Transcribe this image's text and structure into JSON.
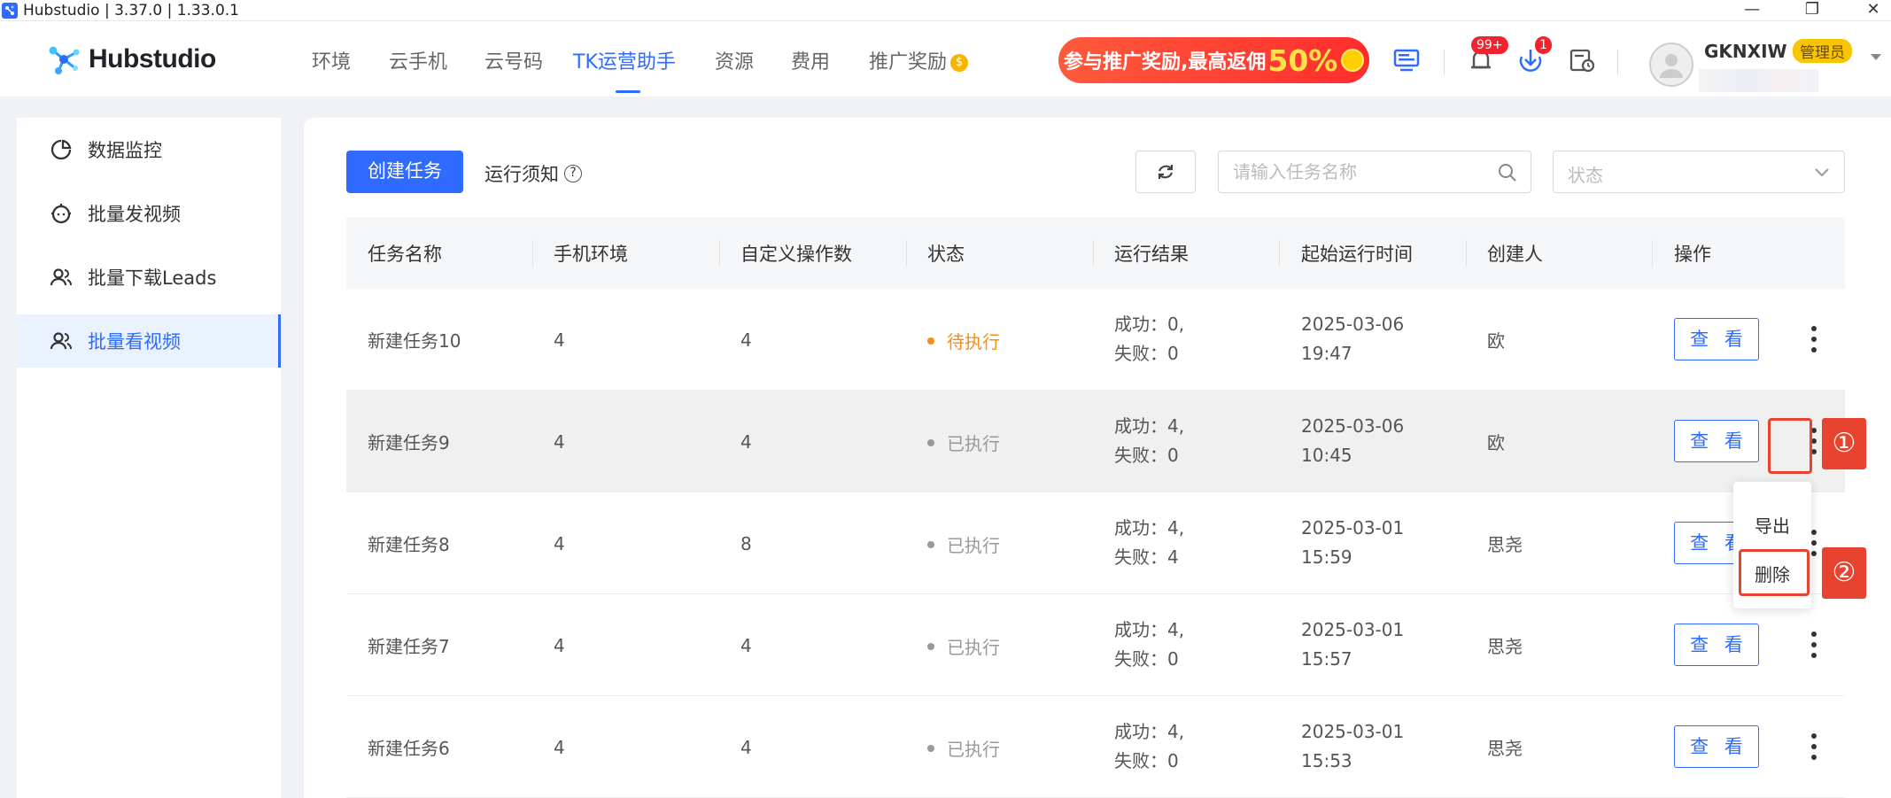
{
  "window": {
    "title": "Hubstudio | 3.37.0 | 1.33.0.1",
    "minimize_glyph": "—",
    "maximize_glyph": "❐",
    "close_glyph": "✕"
  },
  "header": {
    "brand": "Hubstudio",
    "nav": [
      {
        "label": "环境"
      },
      {
        "label": "云手机"
      },
      {
        "label": "云号码"
      },
      {
        "label": "TK运营助手"
      },
      {
        "label": "资源"
      },
      {
        "label": "费用"
      },
      {
        "label": "推广奖励"
      }
    ],
    "active_nav": "TK运营助手",
    "reward_coin": "$",
    "promo": {
      "text": "参与推广奖励,最高返佣",
      "highlight": "50%"
    },
    "notification_badge": "99+",
    "download_badge": "1",
    "username": "GKNXIW",
    "role": "管理员"
  },
  "sidebar": {
    "items": [
      {
        "label": "数据监控",
        "icon": "chart-pie-icon"
      },
      {
        "label": "批量发视频",
        "icon": "robot-icon"
      },
      {
        "label": "批量下载Leads",
        "icon": "users-icon"
      },
      {
        "label": "批量看视频",
        "icon": "users-icon"
      }
    ],
    "active_index": 3
  },
  "toolbar": {
    "create_label": "创建任务",
    "notice_label": "运行须知",
    "notice_icon": "?",
    "search_placeholder": "请输入任务名称",
    "status_placeholder": "状态"
  },
  "table": {
    "columns": [
      "任务名称",
      "手机环境",
      "自定义操作数",
      "状态",
      "运行结果",
      "起始运行时间",
      "创建人",
      "操作"
    ],
    "view_label": "查 看",
    "rows": [
      {
        "name": "新建任务10",
        "env": "4",
        "ops": "4",
        "status": "待执行",
        "status_color": "#fa8c16",
        "success": "成功：0,",
        "fail": "失败：0",
        "date": "2025-03-06",
        "time": "19:47",
        "creator": "欧"
      },
      {
        "name": "新建任务9",
        "env": "4",
        "ops": "4",
        "status": "已执行",
        "status_color": "#999999",
        "success": "成功：4,",
        "fail": "失败：0",
        "date": "2025-03-06",
        "time": "10:45",
        "creator": "欧"
      },
      {
        "name": "新建任务8",
        "env": "4",
        "ops": "8",
        "status": "已执行",
        "status_color": "#999999",
        "success": "成功：4,",
        "fail": "失败：4",
        "date": "2025-03-01",
        "time": "15:59",
        "creator": "思尧"
      },
      {
        "name": "新建任务7",
        "env": "4",
        "ops": "4",
        "status": "已执行",
        "status_color": "#999999",
        "success": "成功：4,",
        "fail": "失败：0",
        "date": "2025-03-01",
        "time": "15:57",
        "creator": "思尧"
      },
      {
        "name": "新建任务6",
        "env": "4",
        "ops": "4",
        "status": "已执行",
        "status_color": "#999999",
        "success": "成功：4,",
        "fail": "失败：0",
        "date": "2025-03-01",
        "time": "15:53",
        "creator": "思尧"
      }
    ]
  },
  "row_menu": {
    "items": [
      "导出",
      "删除"
    ]
  },
  "annotations": [
    "①",
    "②"
  ],
  "colors": {
    "accent": "#2f6bff",
    "pending": "#fa8c16",
    "done": "#999999",
    "annotation": "#e8432e"
  }
}
